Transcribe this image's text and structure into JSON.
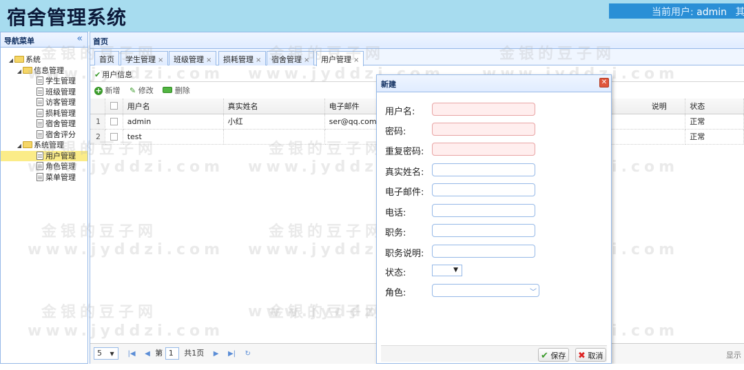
{
  "app": {
    "title": "宿舍管理系统",
    "current_user_label": "当前用户:",
    "current_user": "admin",
    "overflow_char": "其"
  },
  "sidebar": {
    "title": "导航菜单",
    "collapse_glyph": "«",
    "tree": {
      "root": "系统",
      "groups": [
        {
          "label": "信息管理",
          "items": [
            "学生管理",
            "班级管理",
            "访客管理",
            "损耗管理",
            "宿舍管理",
            "宿舍评分"
          ]
        },
        {
          "label": "系统管理",
          "items": [
            "用户管理",
            "角色管理",
            "菜单管理"
          ],
          "selected": "用户管理"
        }
      ]
    }
  },
  "main": {
    "panel_title": "首页",
    "tabs": [
      "首页",
      "学生管理",
      "班级管理",
      "损耗管理",
      "宿舍管理",
      "用户管理"
    ],
    "active_tab": "用户管理",
    "section_title": "用户信息",
    "toolbar": {
      "add": "新增",
      "edit": "修改",
      "delete": "删除"
    },
    "grid": {
      "columns": [
        "用户名",
        "真实姓名",
        "电子邮件",
        "说明",
        "状态"
      ],
      "rows": [
        {
          "no": "1",
          "username": "admin",
          "realname": "小红",
          "email": "ser@qq.com",
          "desc": "",
          "status": "正常"
        },
        {
          "no": "2",
          "username": "test",
          "realname": "",
          "email": "",
          "desc": "",
          "status": "正常"
        }
      ]
    },
    "pager": {
      "page_size": "5",
      "page_prefix": "第",
      "page": "1",
      "total": "共1页",
      "display": "显示"
    }
  },
  "dialog": {
    "title": "新建",
    "fields": {
      "username": "用户名:",
      "password": "密码:",
      "repeat_password": "重复密码:",
      "realname": "真实姓名:",
      "email": "电子邮件:",
      "phone": "电话:",
      "position": "职务:",
      "position_desc": "职务说明:",
      "status": "状态:",
      "role": "角色:"
    },
    "save": "保存",
    "cancel": "取消"
  },
  "watermark": {
    "line1": "金银的豆子网",
    "line2": "www.jyddzi.com"
  },
  "colors": {
    "header_bg": "#a7dcef",
    "user_area_bg": "#2a8fd6",
    "border": "#95b8e7",
    "selected_node": "#fbec88",
    "required_field": "#ffeeee"
  }
}
